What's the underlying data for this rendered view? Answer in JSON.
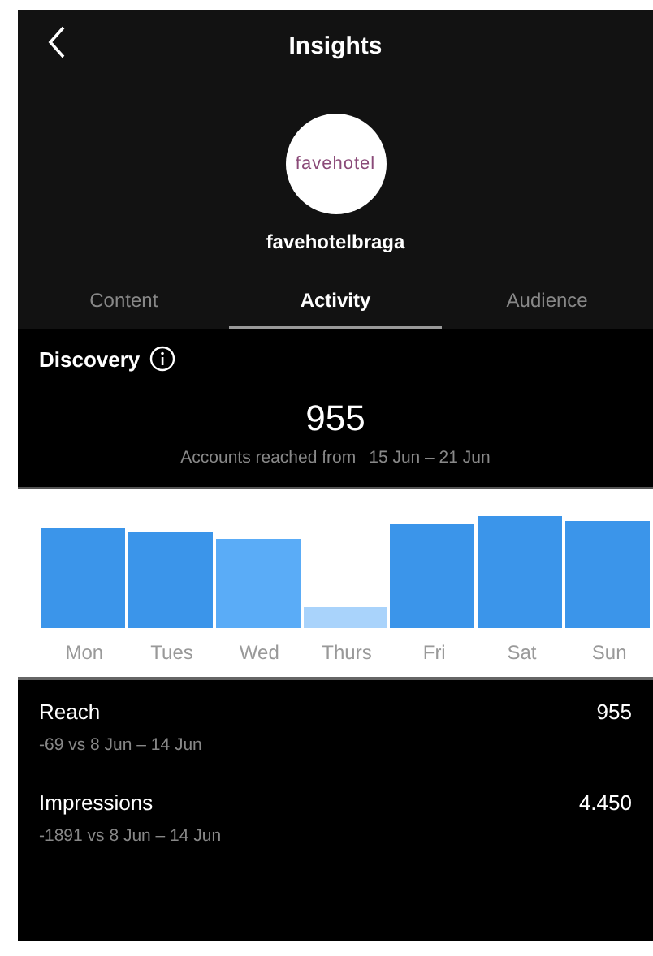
{
  "header": {
    "title": "Insights"
  },
  "profile": {
    "logo_text": "favehotel",
    "username": "favehotelbraga"
  },
  "tabs": [
    {
      "label": "Content",
      "selected": false
    },
    {
      "label": "Activity",
      "selected": true
    },
    {
      "label": "Audience",
      "selected": false
    }
  ],
  "discovery": {
    "title": "Discovery",
    "value": "955",
    "caption": "Accounts reached from",
    "range": "15 Jun – 21 Jun"
  },
  "chart": {
    "days": [
      "Mon",
      "Tues",
      "Wed",
      "Thurs",
      "Fri",
      "Sat",
      "Sun"
    ]
  },
  "metrics": [
    {
      "label": "Reach",
      "value": "955",
      "change": "-69 vs 8 Jun – 14 Jun"
    },
    {
      "label": "Impressions",
      "value": "4.450",
      "change": "-1891 vs 8 Jun – 14 Jun"
    }
  ]
}
